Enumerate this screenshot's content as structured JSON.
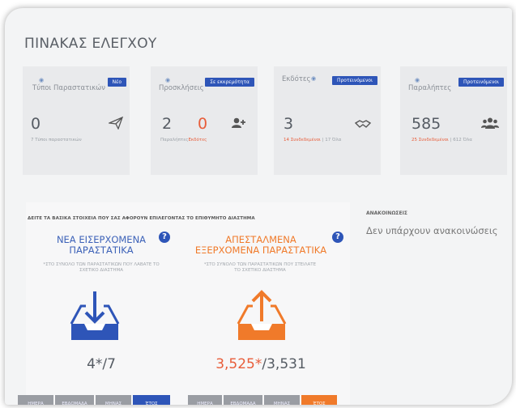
{
  "page": {
    "title": "ΠΙΝΑΚΑΣ ΕΛΕΓΧΟΥ"
  },
  "cards": [
    {
      "badge": "Νέο",
      "title": "Τύποι Παραστατικών",
      "value": "0",
      "sub": "7 Τύποι παραστατικών",
      "icon": "paper-plane-icon"
    },
    {
      "badge": "Σε εκκρεμότητα",
      "title": "Προσκλήσεις",
      "value": "2",
      "value2": "0",
      "sub_a": "Παραλήπτες",
      "sub_b": "Εκδότες",
      "icon": "user-plus-icon"
    },
    {
      "badge": "Προτεινόμενοι",
      "title": "Εκδότες",
      "value": "3",
      "sub_red": "14 Συνδεδεμένοι",
      "sub_sep": " | ",
      "sub_rest": "17 Όλα",
      "icon": "handshake-icon"
    },
    {
      "badge": "Προτεινόμενοι",
      "title": "Παραλήπτες",
      "value": "585",
      "sub_red": "25 Συνδεδεμένοι",
      "sub_sep": " | ",
      "sub_rest": "612 Όλα",
      "icon": "users-icon"
    }
  ],
  "section": {
    "title": "ΔΕΙΤΕ ΤΑ ΒΑΣΙΚΑ ΣΤΟΙΧΕΙΑ ΠΟΥ ΣΑΣ ΑΦΟΡΟΥΝ ΕΠΙΛΕΓΟΝΤΑΣ ΤΟ ΕΠΙΘΥΜΗΤΟ ΔΙΑΣΤΗΜΑ"
  },
  "incoming": {
    "title_line1": "ΝΕΑ ΕΙΣΕΡΧΟΜΕΝΑ",
    "title_line2": "ΠΑΡΑΣΤΑΤΙΚΑ",
    "note_line1": "*ΣΤΟ ΣΥΝΟΛΟ ΤΩΝ ΠΑΡΑΣΤΑΤΙΚΩΝ ΠΟΥ ΛΑΒΑΤΕ ΤΟ",
    "note_line2": "ΣΧΕΤΙΚΟ ΔΙΑΣΤΗΜΑ",
    "count_new": "4*",
    "count_total": "/7",
    "buttons": [
      "ΗΜΕΡΑ",
      "ΕΒΔΟΜΑΔΑ",
      "ΜΗΝΑΣ",
      "ΈΤΟΣ"
    ],
    "active_index": 3,
    "accent": "#2e55b8"
  },
  "outgoing": {
    "title_line1": "ΑΠΕΣΤΑΛΜΕΝΑ",
    "title_line2": "ΕΞΕΡΧΟΜΕΝΑ ΠΑΡΑΣΤΑΤΙΚΑ",
    "note_line1": "*ΣΤΟ ΣΥΝΟΛΟ ΤΩΝ ΠΑΡΑΣΤΑΤΙΚΩΝ ΠΟΥ ΣΤΕΙΛΑΤΕ",
    "note_line2": "ΤΟ ΣΧΕΤΙΚΟ ΔΙΑΣΤΗΜΑ",
    "count_new": "3,525*",
    "count_total": "/3,531",
    "buttons": [
      "ΗΜΕΡΑ",
      "ΕΒΔΟΜΑΔΑ",
      "ΜΗΝΑΣ",
      "ΈΤΟΣ"
    ],
    "active_index": 3,
    "accent": "#f07a2a"
  },
  "announcements": {
    "title": "ΑΝΑΚΟΙΝΩΣΕΙΣ",
    "empty_text": "Δεν υπάρχουν ανακοινώσεις"
  },
  "help_label": "?"
}
